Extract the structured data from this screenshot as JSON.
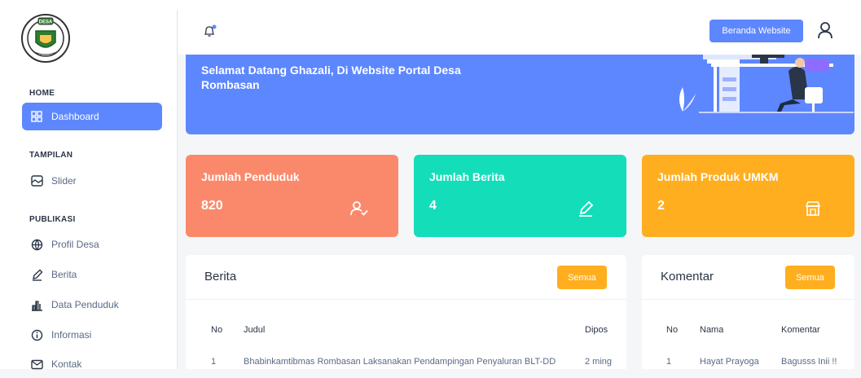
{
  "sidebar": {
    "logo_text": "DESA",
    "sections": {
      "home": "HOME",
      "tampilan": "TAMPILAN",
      "publikasi": "PUBLIKASI"
    },
    "items": [
      {
        "label": "Dashboard",
        "icon": "dashboard-icon",
        "active": true
      },
      {
        "label": "Slider",
        "icon": "slider-icon"
      },
      {
        "label": "Profil Desa",
        "icon": "globe-icon"
      },
      {
        "label": "Berita",
        "icon": "edit-icon"
      },
      {
        "label": "Data Penduduk",
        "icon": "chart-icon"
      },
      {
        "label": "Informasi",
        "icon": "info-icon"
      },
      {
        "label": "Kontak",
        "icon": "mail-icon"
      }
    ]
  },
  "header": {
    "notification_icon": "bell-icon",
    "website_button": "Beranda Website",
    "user_icon": "user-icon"
  },
  "banner": {
    "welcome_text": "Selamat Datang Ghazali, Di Website Portal Desa Rombasan"
  },
  "cards": [
    {
      "title": "Jumlah Penduduk",
      "value": "820",
      "icon": "user-check-icon",
      "color": "#fa896b"
    },
    {
      "title": "Jumlah Berita",
      "value": "4",
      "icon": "edit-icon",
      "color": "#13deb9"
    },
    {
      "title": "Jumlah Produk UMKM",
      "value": "2",
      "icon": "store-icon",
      "color": "#ffae1f"
    }
  ],
  "berita_panel": {
    "title": "Berita",
    "button": "Semua",
    "columns": [
      "No",
      "Judul",
      "Dipos"
    ],
    "rows": [
      {
        "no": "1",
        "judul": "Bhabinkamtibmas Rombasan Laksanakan Pendampingan Penyaluran BLT-DD",
        "diposting": "2 ming"
      }
    ]
  },
  "komentar_panel": {
    "title": "Komentar",
    "button": "Semua",
    "columns": [
      "No",
      "Nama",
      "Komentar"
    ],
    "rows": [
      {
        "no": "1",
        "nama": "Hayat Prayoga",
        "komentar": "Bagusss Inii !!"
      }
    ]
  },
  "colors": {
    "primary": "#5d87ff",
    "warning": "#ffae1f",
    "danger": "#fa896b",
    "success": "#13deb9"
  }
}
